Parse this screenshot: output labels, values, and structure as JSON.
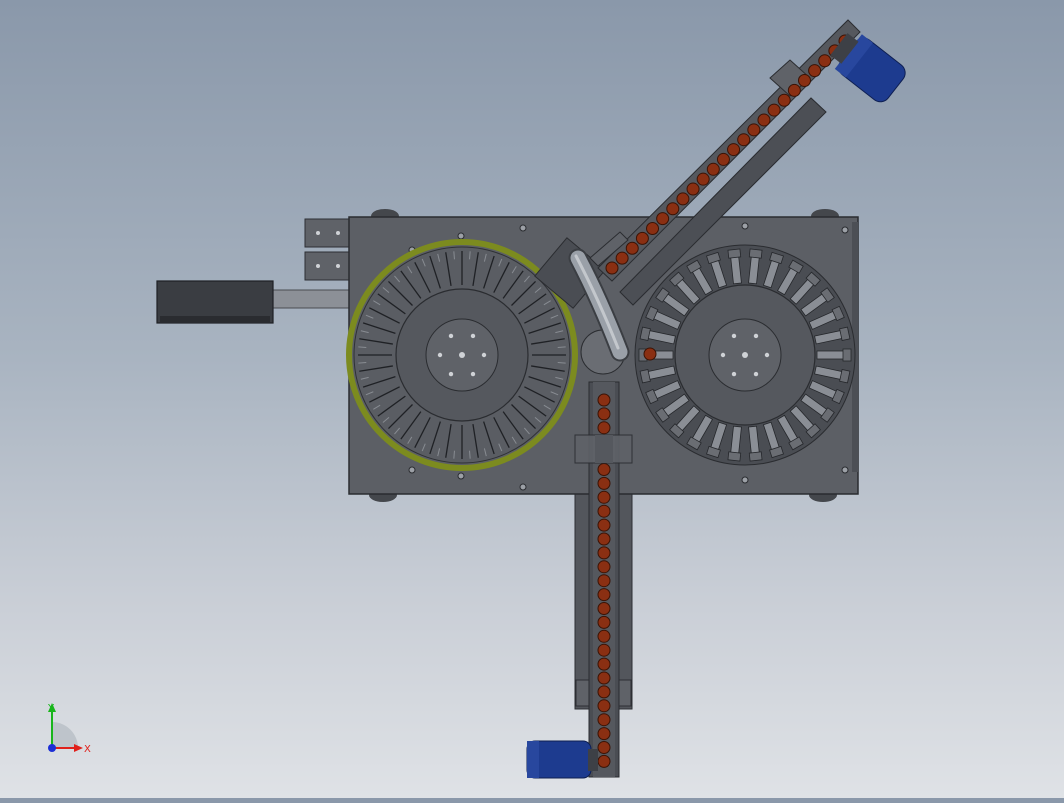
{
  "viewport": {
    "triad": {
      "x_label": "X",
      "y_label": "Y",
      "x_color": "#e0201b",
      "y_color": "#19b51c",
      "z_color": "#1c2fd6"
    }
  },
  "model": {
    "frame_color": "#5a5d63",
    "frame_dark": "#3c3f44",
    "ring_color": "#7a8a1e",
    "product_color": "#8a2f12",
    "motor_color": "#1d3b8f",
    "chute_inclined_count": 24,
    "chute_vertical_count": 27,
    "left_wheel_slots": 40,
    "right_wheel_slots": 30
  }
}
